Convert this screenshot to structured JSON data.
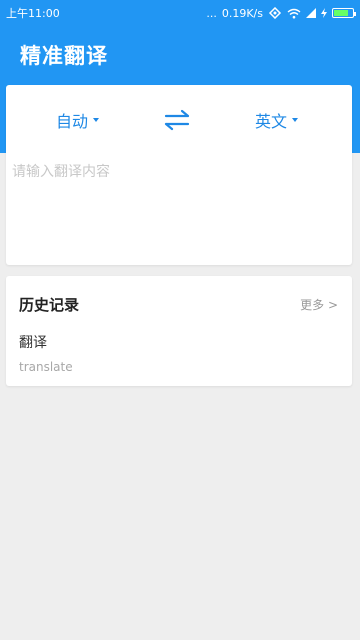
{
  "status_bar": {
    "time": "上午11:00",
    "dots": "...",
    "speed": "0.19K/s",
    "battery_accent": "#66ff66"
  },
  "app": {
    "title": "精准翻译"
  },
  "translate": {
    "source_lang": "自动",
    "target_lang": "英文",
    "input_placeholder": "请输入翻译内容",
    "input_value": ""
  },
  "history": {
    "title": "历史记录",
    "more_label": "更多 >",
    "items": [
      {
        "source": "翻译",
        "target": "translate"
      }
    ]
  },
  "colors": {
    "primary": "#2196f3",
    "accent_text": "#1e88e5",
    "background": "#eeeeee"
  }
}
